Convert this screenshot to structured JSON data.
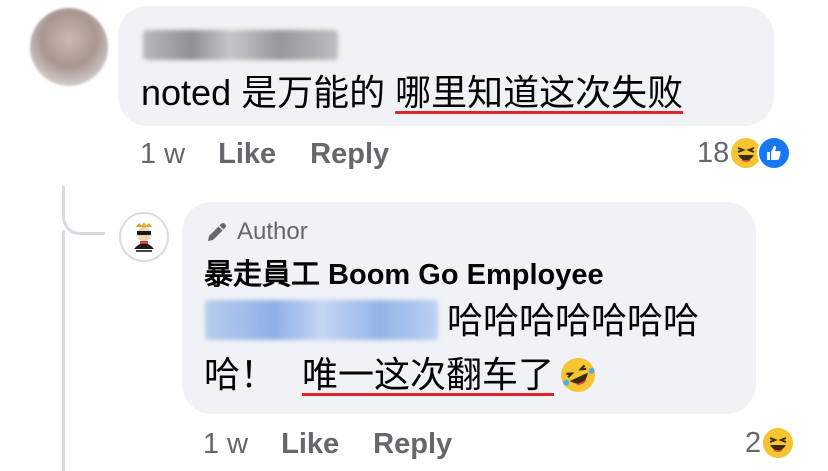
{
  "top_comment": {
    "text_plain": "noted 是万能的 ",
    "text_underlined": "哪里知道这次失败",
    "time": "1 w",
    "like_label": "Like",
    "reply_label": "Reply",
    "reaction_count": "18",
    "reaction_icons": [
      "haha-emoji-icon",
      "like-thumb-icon"
    ]
  },
  "reply_comment": {
    "badge_label": "Author",
    "author_name": "暴走員工 Boom Go Employee",
    "text_line1": "哈哈哈哈哈哈哈",
    "text_line2_prefix": "哈！",
    "text_line2_underlined": "唯一这次翻车了",
    "time": "1 w",
    "like_label": "Like",
    "reply_label": "Reply",
    "reaction_count": "2",
    "reaction_icons": [
      "haha-emoji-icon"
    ]
  },
  "colors": {
    "bubble_bg": "#f0f2f5",
    "meta_text": "#65676b",
    "body_text": "#050505",
    "underline_red": "#e0242b",
    "like_blue": "#1877f2",
    "haha_yellow": "#f7c531",
    "mention_blue": "#8fb0e6"
  }
}
